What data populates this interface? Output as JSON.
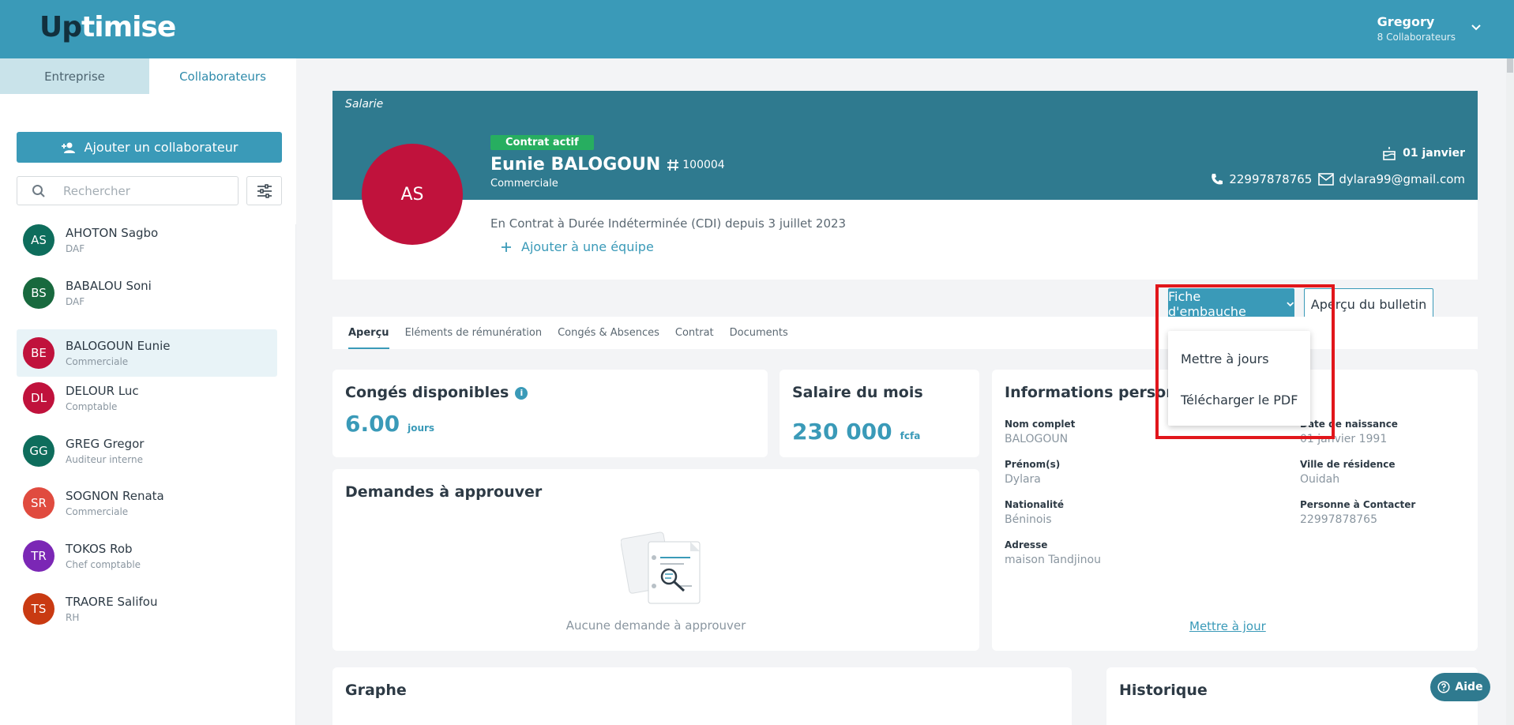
{
  "app": {
    "logo_part1": "Up",
    "logo_part2": "timise"
  },
  "user": {
    "name": "Gregory",
    "subtitle": "8 Collaborateurs"
  },
  "sidebar": {
    "tabs": [
      {
        "label": "Entreprise"
      },
      {
        "label": "Collaborateurs"
      }
    ],
    "add_button": "Ajouter un collaborateur",
    "search_placeholder": "Rechercher",
    "employees": [
      {
        "initials": "AS",
        "name": "AHOTON Sagbo",
        "role": "DAF",
        "color": "#0e6d5c"
      },
      {
        "initials": "BS",
        "name": "BABALOU Soni",
        "role": "DAF",
        "color": "#18693e"
      },
      {
        "initials": "BE",
        "name": "BALOGOUN Eunie",
        "role": "Commerciale",
        "color": "#c0123c"
      },
      {
        "initials": "DL",
        "name": "DELOUR Luc",
        "role": "Comptable",
        "color": "#c0123c"
      },
      {
        "initials": "GG",
        "name": "GREG Gregor",
        "role": "Auditeur interne",
        "color": "#0e6d5c"
      },
      {
        "initials": "SR",
        "name": "SOGNON Renata",
        "role": "Commerciale",
        "color": "#e04b3f"
      },
      {
        "initials": "TR",
        "name": "TOKOS Rob",
        "role": "Chef comptable",
        "color": "#7b27b5"
      },
      {
        "initials": "TS",
        "name": "TRAORE Salifou",
        "role": "RH",
        "color": "#c93a12"
      }
    ]
  },
  "profile": {
    "section_label": "Salarie",
    "initials": "AS",
    "status": "Contrat actif",
    "name": "Eunie BALOGOUN",
    "id": "100004",
    "job": "Commerciale",
    "birthday": "01 janvier",
    "phone": "22997878765",
    "email": "dylara99@gmail.com",
    "contract_text": "En Contrat à Durée Indéterminée (CDI) depuis 3 juillet 2023",
    "add_team": "Ajouter à une équipe",
    "fiche_button": "Fiche d'embauche",
    "bulletin_button": "Aperçu du bulletin",
    "dropdown": [
      "Mettre à jours",
      "Télécharger le PDF"
    ]
  },
  "tabs": [
    "Aperçu",
    "Eléments de rémunération",
    "Congés & Absences",
    "Contrat",
    "Documents"
  ],
  "conges": {
    "title": "Congés disponibles",
    "value": "6.00",
    "unit": "jours"
  },
  "salaire": {
    "title": "Salaire du mois",
    "value": "230 000",
    "unit": "fcfa"
  },
  "demandes": {
    "title": "Demandes à approuver",
    "empty": "Aucune demande à approuver"
  },
  "personal": {
    "title": "Informations personnelles",
    "fields": {
      "nom": {
        "label": "Nom complet",
        "value": "BALOGOUN"
      },
      "prenom": {
        "label": "Prénom(s)",
        "value": "Dylara"
      },
      "nationalite": {
        "label": "Nationalité",
        "value": "Béninois"
      },
      "adresse": {
        "label": "Adresse",
        "value": "maison Tandjinou"
      },
      "naissance": {
        "label": "Date de naissance",
        "value": "01 janvier 1991"
      },
      "ville": {
        "label": "Ville de résidence",
        "value": "Ouidah"
      },
      "contact": {
        "label": "Personne à Contacter",
        "value": "22997878765"
      }
    },
    "update_link": "Mettre à jour"
  },
  "graphe": {
    "title": "Graphe"
  },
  "historique": {
    "title": "Historique"
  },
  "help": {
    "label": "Aide"
  }
}
